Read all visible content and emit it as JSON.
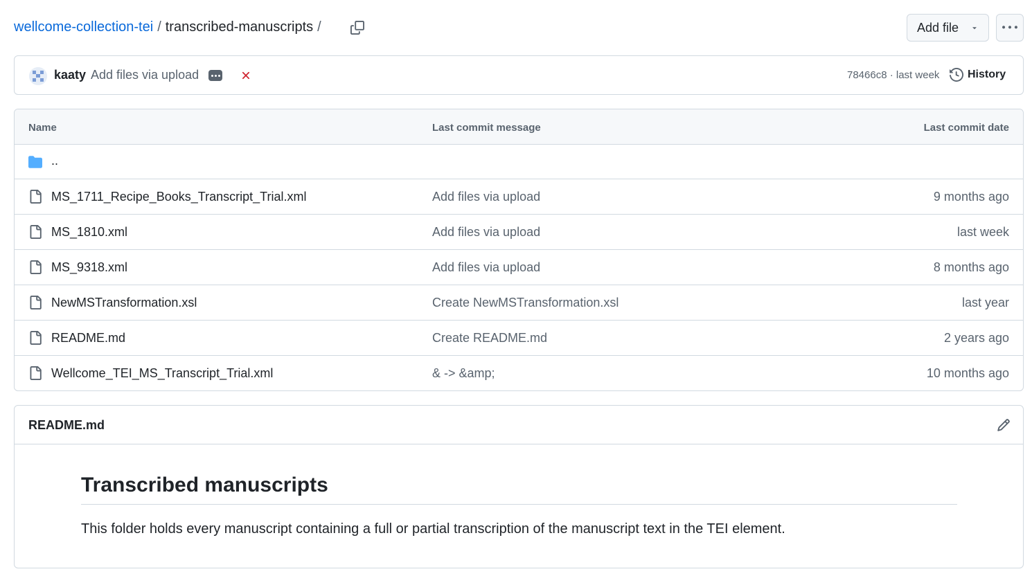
{
  "breadcrumb": {
    "repo": "wellcome-collection-tei",
    "sep1": "/",
    "folder": "transcribed-manuscripts",
    "sep2": "/"
  },
  "toolbar": {
    "add_file_label": "Add file",
    "more_label": "···"
  },
  "commit": {
    "author": "kaaty",
    "message": "Add files via upload",
    "sha_time": "78466c8 · last week",
    "history_label": "History",
    "status_color": "#cf222e"
  },
  "table": {
    "headers": {
      "name": "Name",
      "message": "Last commit message",
      "date": "Last commit date"
    },
    "parent_label": "..",
    "rows": [
      {
        "name": "MS_1711_Recipe_Books_Transcript_Trial.xml",
        "message": "Add files via upload",
        "date": "9 months ago"
      },
      {
        "name": "MS_1810.xml",
        "message": "Add files via upload",
        "date": "last week"
      },
      {
        "name": "MS_9318.xml",
        "message": "Add files via upload",
        "date": "8 months ago"
      },
      {
        "name": "NewMSTransformation.xsl",
        "message": "Create NewMSTransformation.xsl",
        "date": "last year"
      },
      {
        "name": "README.md",
        "message": "Create README.md",
        "date": "2 years ago"
      },
      {
        "name": "Wellcome_TEI_MS_Transcript_Trial.xml",
        "message": "& -> &amp;",
        "date": "10 months ago"
      }
    ]
  },
  "readme": {
    "file_label": "README.md",
    "heading": "Transcribed manuscripts",
    "paragraph": "This folder holds every manuscript containing a full or partial transcription of the manuscript text in the TEI element."
  },
  "colors": {
    "link": "#0969da",
    "folder_icon": "#54aeff",
    "muted": "#59636e",
    "border": "#d1d9e0"
  }
}
